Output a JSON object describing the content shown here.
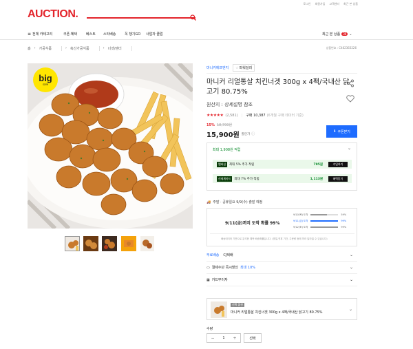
{
  "header": {
    "logo": "AUCTION.",
    "util_links": [
      "로그인",
      "회원가입",
      "고객센터",
      "최근 본 상품"
    ],
    "gnb": [
      {
        "label": "전체 카테고리"
      },
      {
        "label": "쿠폰·혜택"
      },
      {
        "label": "베스트"
      },
      {
        "label": "스타배송"
      },
      {
        "label": "꼭 챙기GO"
      },
      {
        "label": "사업자 클럽"
      }
    ],
    "recent": "최근 본 상품",
    "recent_count": "36"
  },
  "breadcrumb": [
    "홈",
    "가공식품",
    "축산가공식품",
    "너겟/텐더"
  ],
  "product_no": "상품번호 : C462363226",
  "product": {
    "seller": "마니커에프앤지",
    "seller_badge": "파워딜러",
    "title": "마니커 리얼통살 치킨너겟 300g x 4팩/국내산 닭고기 80.75%",
    "origin": "원산지 : 상세설명 참조",
    "rating_count": "(2,581)",
    "purchase_count": "구매 10,387",
    "purchase_note": "(6개월 구매 데이터 기준)",
    "discount": "15%",
    "original_price": "18,700원",
    "price": "15,900원",
    "price_suffix": "할인가",
    "coupon_button": "쿠폰받기",
    "big_badge": "big",
    "big_sub": "sale"
  },
  "benefits": {
    "max_label": "최대 1,908원 적립",
    "rows": [
      {
        "tag": "멤버십",
        "text": "최대 5% 추가 적립",
        "amount": "795원",
        "button": "가입하기"
      },
      {
        "tag": "신세계카드",
        "text": "최대 7% 추가 적립",
        "amount": "1,113원",
        "button": "혜택받기"
      }
    ]
  },
  "shipping": {
    "title": "주말 · 공휴일요 9/9(수) 출발 예정",
    "headline": "9/11(금)까지 도착 확률 99%",
    "bars": [
      {
        "label": "9/10(목) 도착",
        "pct": "59%",
        "value": 0.59
      },
      {
        "label": "9/11(금) 도착",
        "pct": "99%",
        "value": 0.99
      },
      {
        "label": "9/12(토) 도착",
        "pct": "99%",
        "value": 0.99
      }
    ],
    "note": "배송데이터 기반으로 분석한 예측 배송확률입니다. (명절,연휴 기간, 주문량 등에 따라 달라질 수 있습니다)"
  },
  "accordions": [
    {
      "label": "무료배송",
      "sub": "CJ택배"
    },
    {
      "label": "결제수단 즉시할인",
      "sub": "최대 10%"
    },
    {
      "label": "카드무이자",
      "sub": ""
    }
  ],
  "selected": {
    "badge": "선택 옵션",
    "title": "마니커 리얼통살 치킨너겟 300g x 4팩/국내산 닭고기 80.75%"
  },
  "quantity": {
    "label": "수량",
    "value": "1",
    "select_label": "선택"
  }
}
